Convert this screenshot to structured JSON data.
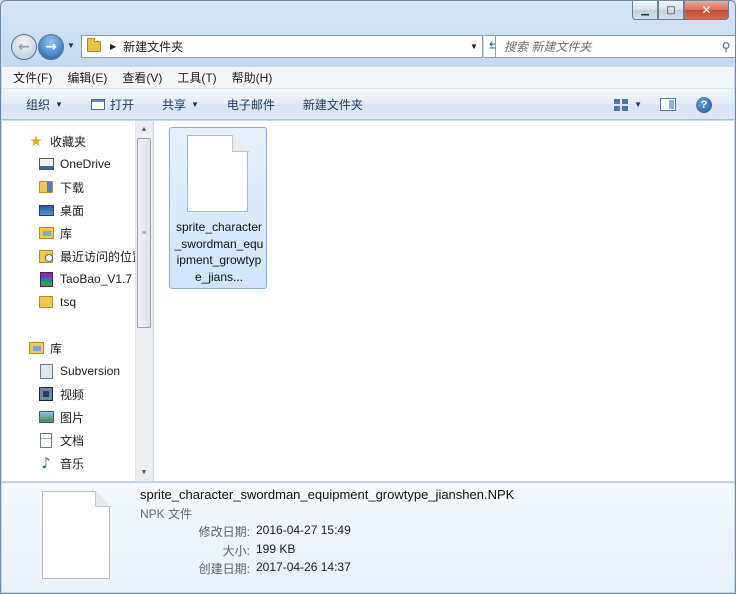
{
  "window": {
    "caption": {
      "minimize": "▁",
      "maximize": "□",
      "close": "✕"
    }
  },
  "nav": {
    "back_icon": "back-arrow-icon",
    "forward_icon": "forward-arrow-icon",
    "breadcrumb": "新建文件夹",
    "search_placeholder": "搜索 新建文件夹"
  },
  "menu": {
    "items": [
      "文件(F)",
      "编辑(E)",
      "查看(V)",
      "工具(T)",
      "帮助(H)"
    ]
  },
  "toolbar": {
    "organize": "组织",
    "open": "打开",
    "share": "共享",
    "email": "电子邮件",
    "new_folder": "新建文件夹"
  },
  "sidebar": {
    "favorites": {
      "label": "收藏夹",
      "items": [
        "OneDrive",
        "下载",
        "桌面",
        "库",
        "最近访问的位置",
        "TaoBao_V1.7",
        "tsq"
      ]
    },
    "libraries": {
      "label": "库",
      "items": [
        "Subversion",
        "视频",
        "图片",
        "文档",
        "音乐"
      ]
    }
  },
  "content": {
    "file_tile_name": "sprite_character_swordman_equipment_growtype_jians..."
  },
  "details": {
    "name": "sprite_character_swordman_equipment_growtype_jianshen.NPK",
    "type": "NPK 文件",
    "modified_label": "修改日期:",
    "modified_value": "2016-04-27 15:49",
    "size_label": "大小:",
    "size_value": "199 KB",
    "created_label": "创建日期:",
    "created_value": "2017-04-26 14:37"
  },
  "colors": {
    "accent": "#3d83d4",
    "selection": "#cfe4fb",
    "chrome": "#c4d8ee"
  }
}
